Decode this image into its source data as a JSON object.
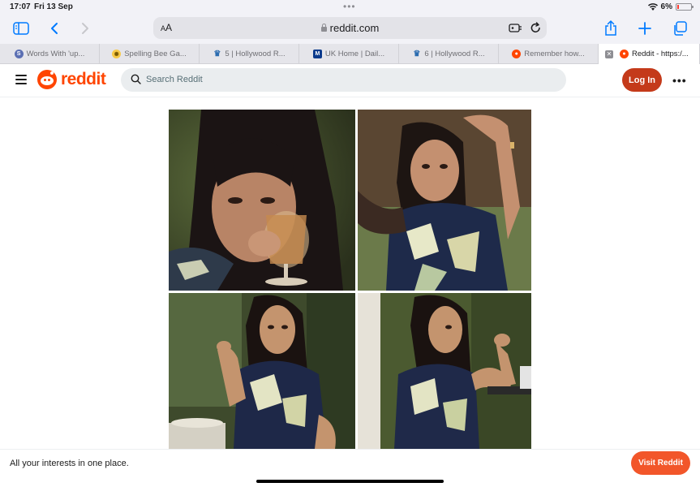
{
  "status": {
    "time": "17:07",
    "date": "Fri 13 Sep",
    "battery": "6%"
  },
  "toolbar": {
    "text_size": "AA",
    "url": "reddit.com"
  },
  "tabs": [
    {
      "label": "Words With 'up...",
      "icon": "s-circle-icon",
      "color": "#5b6fb3"
    },
    {
      "label": "Spelling Bee Ga...",
      "icon": "bee-icon",
      "color": "#f7c948"
    },
    {
      "label": "5 | Hollywood R...",
      "icon": "crown-icon",
      "color": "#2b6cb0"
    },
    {
      "label": "UK Home | Dail...",
      "icon": "m-square-icon",
      "color": "#0b3a8c"
    },
    {
      "label": "6 | Hollywood R...",
      "icon": "crown-icon",
      "color": "#2b6cb0"
    },
    {
      "label": "Remember how...",
      "icon": "reddit-icon",
      "color": "#ff4500"
    },
    {
      "label": "Reddit - https:/...",
      "icon": "reddit-icon",
      "color": "#ff4500",
      "active": true
    }
  ],
  "reddit": {
    "logo_text": "reddit",
    "search_placeholder": "Search Reddit",
    "login_label": "Log In",
    "more_label": "•••"
  },
  "banner": {
    "message": "All your interests in one place.",
    "button_label": "Visit Reddit"
  },
  "colors": {
    "reddit_orange": "#ff4500",
    "login_bg": "#c43a1a",
    "visit_bg": "#f2562a",
    "safari_blue": "#007aff"
  }
}
